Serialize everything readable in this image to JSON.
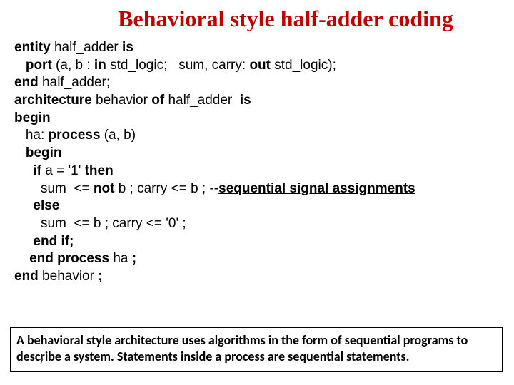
{
  "title": "Behavioral style half-adder coding",
  "code": {
    "l1a": "entity",
    "l1b": " half_adder ",
    "l1c": "is",
    "l2a": "   port",
    "l2b": " (a, b : ",
    "l2c": "in",
    "l2d": " std_logic;   sum, carry: ",
    "l2e": "out",
    "l2f": " std_logic);",
    "l3a": "end",
    "l3b": " half_adder;",
    "l4a": "architecture",
    "l4b": " behavior ",
    "l4c": "of",
    "l4d": " half_adder  ",
    "l4e": "is",
    "l5": "begin",
    "l6a": "   ha: ",
    "l6b": "process",
    "l6c": " (a, b)",
    "l7": "   begin",
    "l8a": "     if",
    "l8b": " a = '1' ",
    "l8c": "then",
    "l9a": "       sum  <= ",
    "l9b": "not",
    "l9c": " b ; carry <= b ; --",
    "l9d": "sequential signal assignments",
    "l10": "     else",
    "l11": "       sum  <= b ; carry <= '0' ;",
    "l12": "     end if;",
    "l13a": "    end process",
    "l13b": " ha ",
    "l13c": ";",
    "l14a": "end",
    "l14b": " behavior ",
    "l14c": ";"
  },
  "note": "A behavioral style architecture uses algorithms in the form of sequential programs to describe a system. Statements inside a process are sequential statements.",
  "page_marker": "7"
}
